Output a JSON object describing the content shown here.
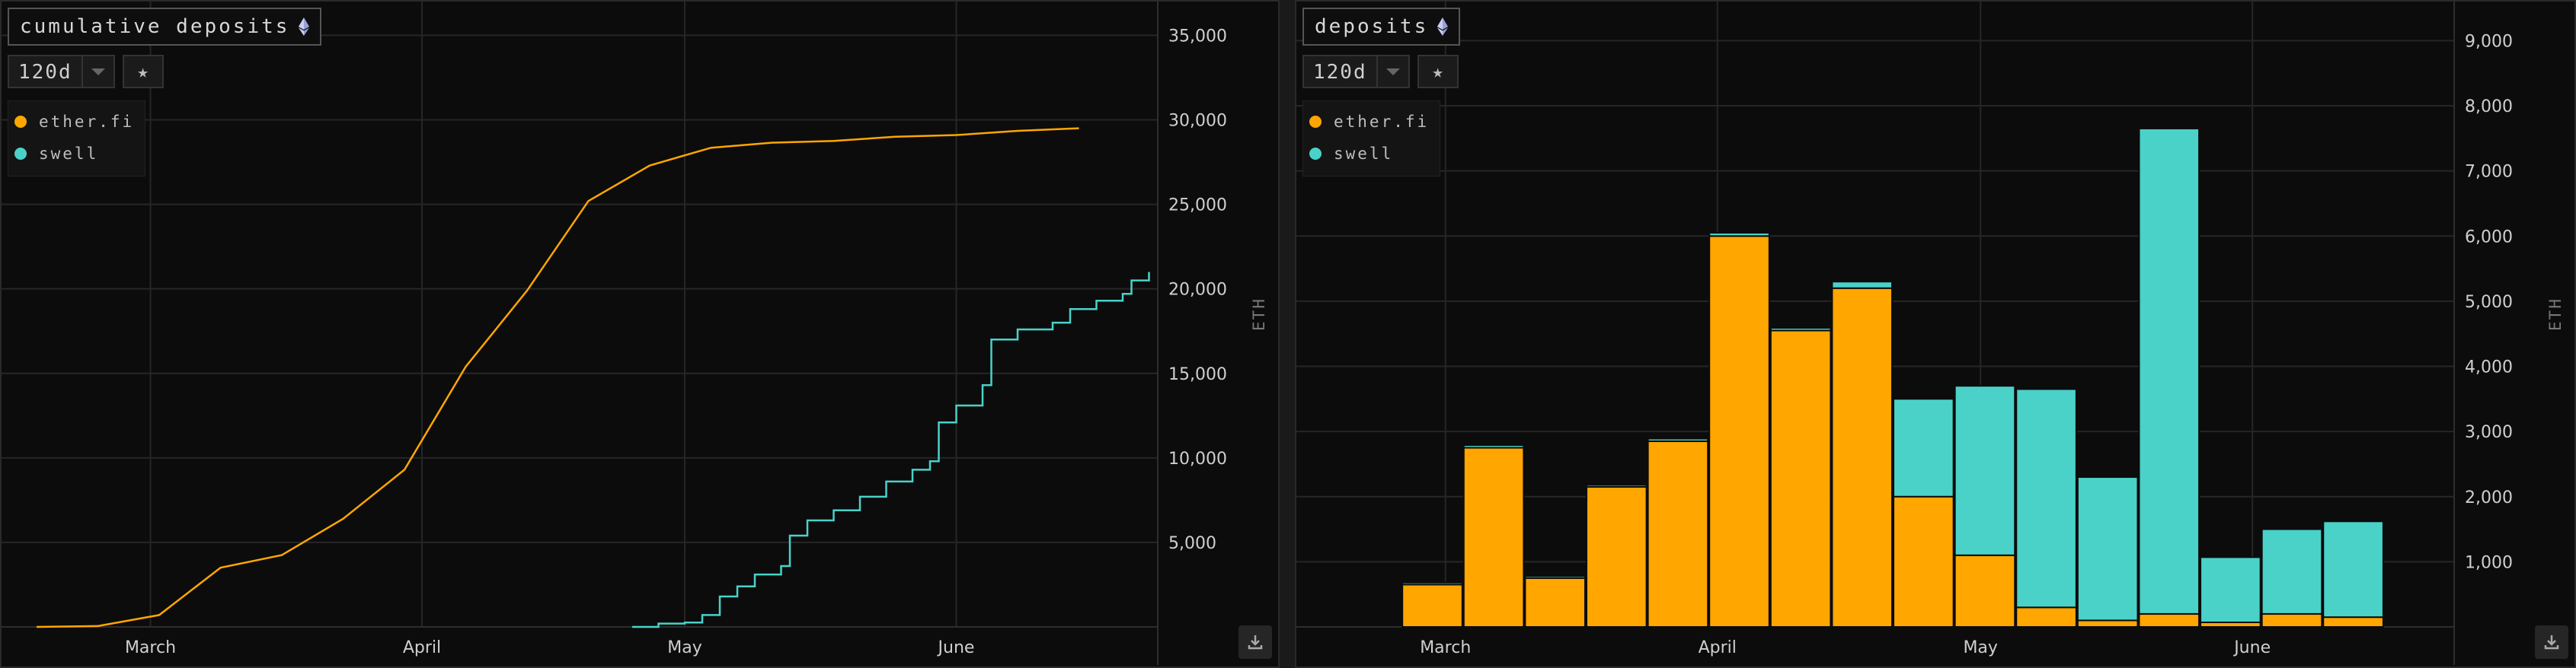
{
  "colors": {
    "etherfi": "#ffa600",
    "swell": "#4ad2c9",
    "grid": "#262626",
    "background": "#0c0c0c"
  },
  "panels": [
    {
      "title": "cumulative deposits",
      "range_label": "120d",
      "icons": [
        "ethereum-icon",
        "chevron-down-icon",
        "star-icon",
        "download-icon"
      ],
      "legend": [
        {
          "label": "ether.fi"
        },
        {
          "label": "swell"
        }
      ]
    },
    {
      "title": "deposits",
      "range_label": "120d",
      "icons": [
        "ethereum-icon",
        "chevron-down-icon",
        "star-icon",
        "download-icon"
      ],
      "legend": [
        {
          "label": "ether.fi"
        },
        {
          "label": "swell"
        }
      ]
    }
  ],
  "chart_data": [
    {
      "type": "line",
      "title": "cumulative deposits",
      "ylabel": "ETH",
      "ylim": [
        0,
        37000
      ],
      "yticks": [
        5000,
        10000,
        15000,
        20000,
        25000,
        30000,
        35000
      ],
      "ytick_labels": [
        "5,000",
        "10,000",
        "15,000",
        "20,000",
        "25,000",
        "30,000",
        "35,000"
      ],
      "xlim": [
        "2024-02-13",
        "2024-06-24"
      ],
      "xticks": [
        {
          "date": "2024-03-01",
          "label": "March"
        },
        {
          "date": "2024-04-01",
          "label": "April"
        },
        {
          "date": "2024-05-01",
          "label": "May"
        },
        {
          "date": "2024-06-01",
          "label": "June"
        }
      ],
      "grid": true,
      "legend_position": "top-left",
      "series": [
        {
          "name": "ether.fi",
          "color": "#ffa600",
          "points": [
            [
              "2024-02-17",
              0
            ],
            [
              "2024-02-24",
              50
            ],
            [
              "2024-03-02",
              700
            ],
            [
              "2024-03-09",
              3500
            ],
            [
              "2024-03-16",
              4250
            ],
            [
              "2024-03-23",
              6400
            ],
            [
              "2024-03-30",
              9300
            ],
            [
              "2024-04-06",
              15400
            ],
            [
              "2024-04-13",
              19900
            ],
            [
              "2024-04-20",
              25200
            ],
            [
              "2024-04-27",
              27300
            ],
            [
              "2024-05-04",
              28350
            ],
            [
              "2024-05-11",
              28650
            ],
            [
              "2024-05-18",
              28750
            ],
            [
              "2024-05-25",
              29000
            ],
            [
              "2024-06-01",
              29100
            ],
            [
              "2024-06-08",
              29350
            ],
            [
              "2024-06-15",
              29500
            ]
          ]
        },
        {
          "name": "swell",
          "color": "#4ad2c9",
          "points": [
            [
              "2024-04-25",
              0
            ],
            [
              "2024-04-28",
              200
            ],
            [
              "2024-05-01",
              260
            ],
            [
              "2024-05-03",
              700
            ],
            [
              "2024-05-05",
              1800
            ],
            [
              "2024-05-07",
              2400
            ],
            [
              "2024-05-09",
              3100
            ],
            [
              "2024-05-12",
              3600
            ],
            [
              "2024-05-13",
              5400
            ],
            [
              "2024-05-15",
              6300
            ],
            [
              "2024-05-18",
              6900
            ],
            [
              "2024-05-21",
              7700
            ],
            [
              "2024-05-24",
              8600
            ],
            [
              "2024-05-27",
              9300
            ],
            [
              "2024-05-29",
              9800
            ],
            [
              "2024-05-30",
              12100
            ],
            [
              "2024-06-01",
              13100
            ],
            [
              "2024-06-04",
              14300
            ],
            [
              "2024-06-05",
              17000
            ],
            [
              "2024-06-08",
              17600
            ],
            [
              "2024-06-12",
              18000
            ],
            [
              "2024-06-14",
              18800
            ],
            [
              "2024-06-17",
              19300
            ],
            [
              "2024-06-20",
              19700
            ],
            [
              "2024-06-21",
              20500
            ],
            [
              "2024-06-23",
              21000
            ]
          ]
        }
      ]
    },
    {
      "type": "bar",
      "stacked": true,
      "title": "deposits",
      "ylabel": "ETH",
      "ylim": [
        0,
        9600
      ],
      "yticks": [
        1000,
        2000,
        3000,
        4000,
        5000,
        6000,
        7000,
        8000,
        9000
      ],
      "ytick_labels": [
        "1,000",
        "2,000",
        "3,000",
        "4,000",
        "5,000",
        "6,000",
        "7,000",
        "8,000",
        "9,000"
      ],
      "xlim": [
        "2024-02-13",
        "2024-06-24"
      ],
      "xticks": [
        {
          "date": "2024-03-01",
          "label": "March"
        },
        {
          "date": "2024-04-01",
          "label": "April"
        },
        {
          "date": "2024-05-01",
          "label": "May"
        },
        {
          "date": "2024-06-01",
          "label": "June"
        }
      ],
      "grid": true,
      "legend_position": "top-left",
      "bar_week_starts": [
        "2024-02-25",
        "2024-03-03",
        "2024-03-10",
        "2024-03-17",
        "2024-03-24",
        "2024-03-31",
        "2024-04-07",
        "2024-04-14",
        "2024-04-21",
        "2024-04-28",
        "2024-05-05",
        "2024-05-12",
        "2024-05-19",
        "2024-05-26",
        "2024-06-02",
        "2024-06-09"
      ],
      "series": [
        {
          "name": "ether.fi",
          "color": "#ffa600",
          "values": [
            650,
            2750,
            750,
            2150,
            2850,
            6000,
            4550,
            5200,
            2000,
            1100,
            300,
            100,
            200,
            70,
            200,
            150
          ]
        },
        {
          "name": "swell",
          "color": "#4ad2c9",
          "values": [
            30,
            40,
            30,
            30,
            40,
            50,
            40,
            100,
            1500,
            2600,
            3350,
            2200,
            7450,
            1000,
            1300,
            1470
          ]
        }
      ]
    }
  ]
}
